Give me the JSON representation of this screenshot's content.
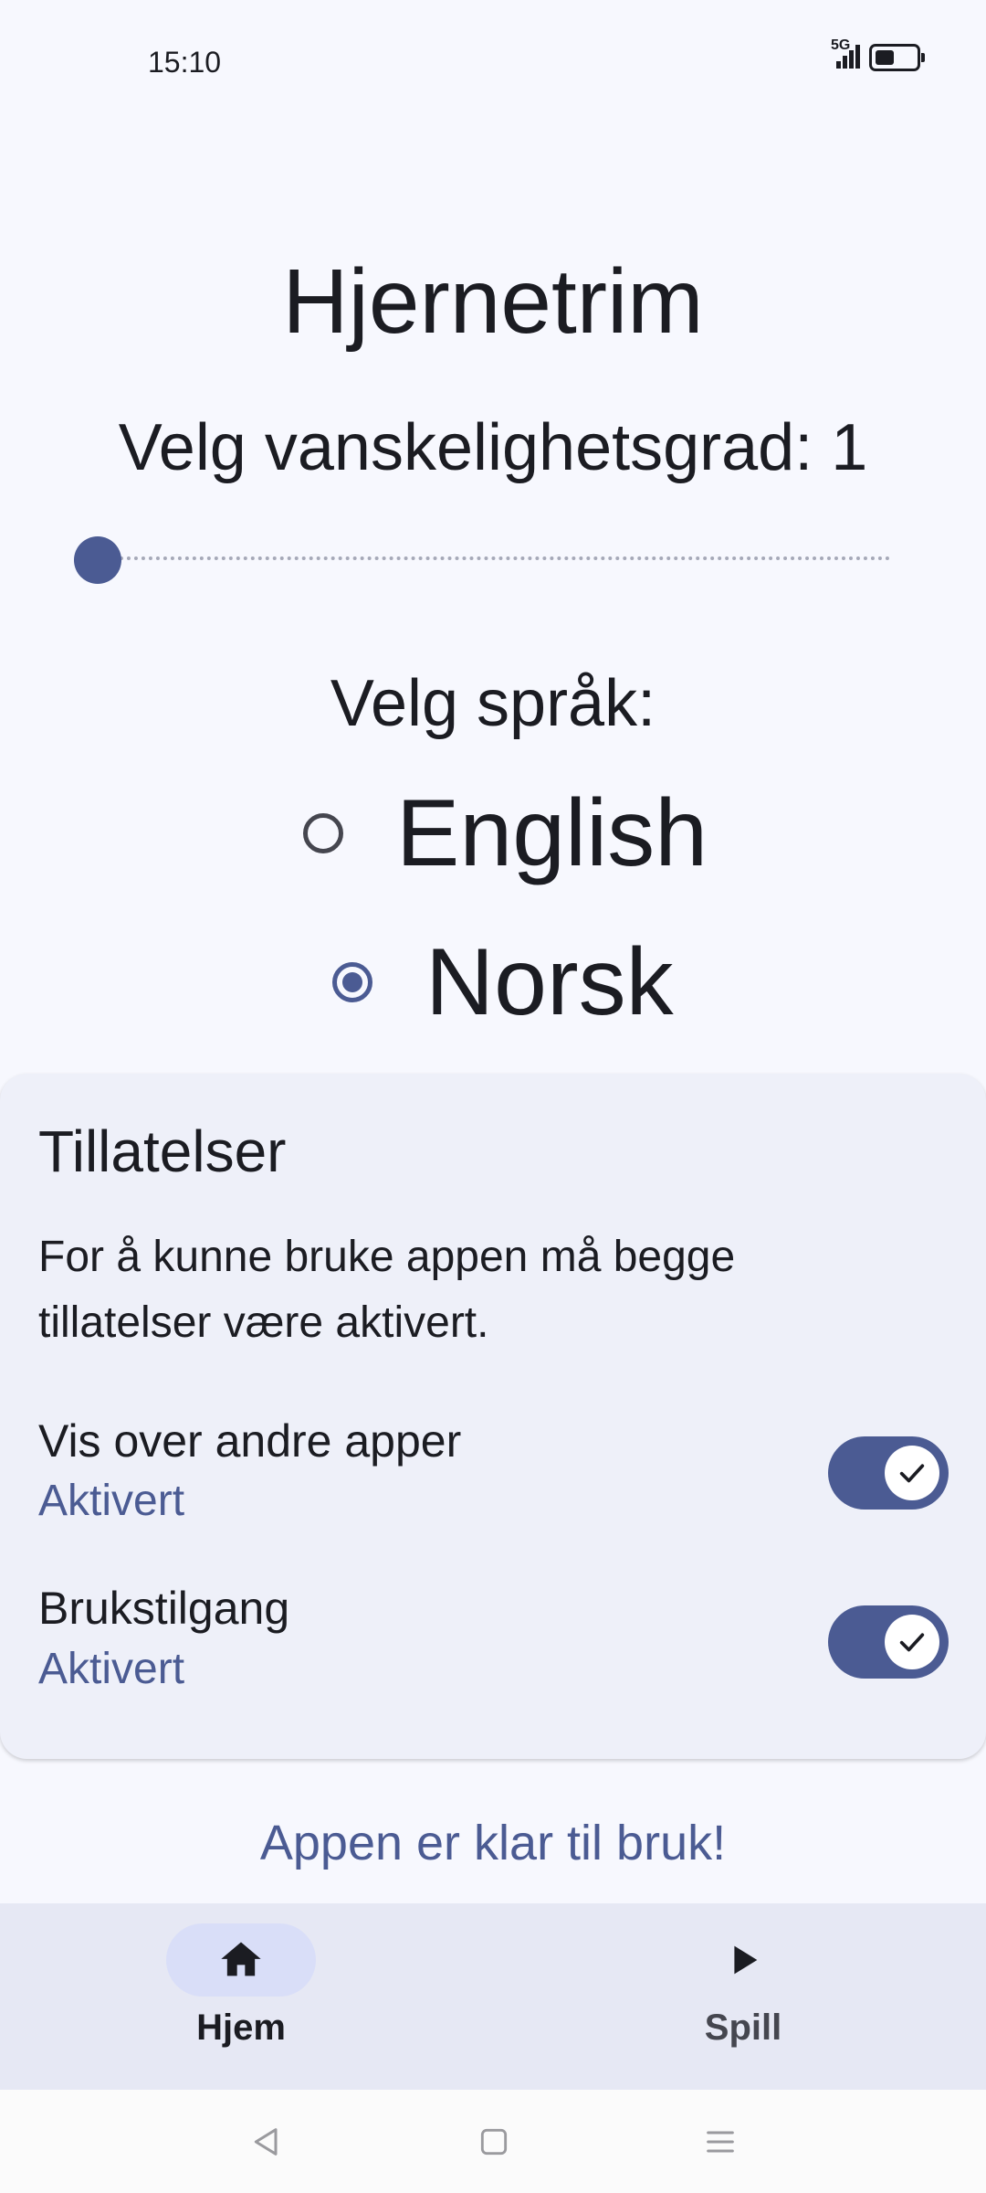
{
  "status_bar": {
    "time": "15:10",
    "network": "5G",
    "icons": [
      "signal-icon",
      "battery-icon"
    ]
  },
  "home": {
    "title": "Hjernetrim",
    "difficulty_label": "Velg vanskelighetsgrad: 1",
    "difficulty_value": 1,
    "difficulty_min": 1,
    "difficulty_max": 10,
    "language_label": "Velg språk:",
    "languages": [
      {
        "label": "English",
        "selected": false
      },
      {
        "label": "Norsk",
        "selected": true
      }
    ]
  },
  "permissions": {
    "title": "Tillatelser",
    "description": "For å kunne bruke appen må begge tillatelser være aktivert.",
    "items": [
      {
        "name": "Vis over andre apper",
        "status": "Aktivert",
        "enabled": true
      },
      {
        "name": "Brukstilgang",
        "status": "Aktivert",
        "enabled": true
      }
    ]
  },
  "ready_message": "Appen er klar til bruk!",
  "bottom_nav": {
    "items": [
      {
        "label": "Hjem",
        "icon": "home-icon",
        "active": true
      },
      {
        "label": "Spill",
        "icon": "play-icon",
        "active": false
      }
    ]
  },
  "colors": {
    "accent": "#4b5b93",
    "background": "#f7f8fe",
    "card": "#eef0f9",
    "nav": "#e6e8f4"
  }
}
